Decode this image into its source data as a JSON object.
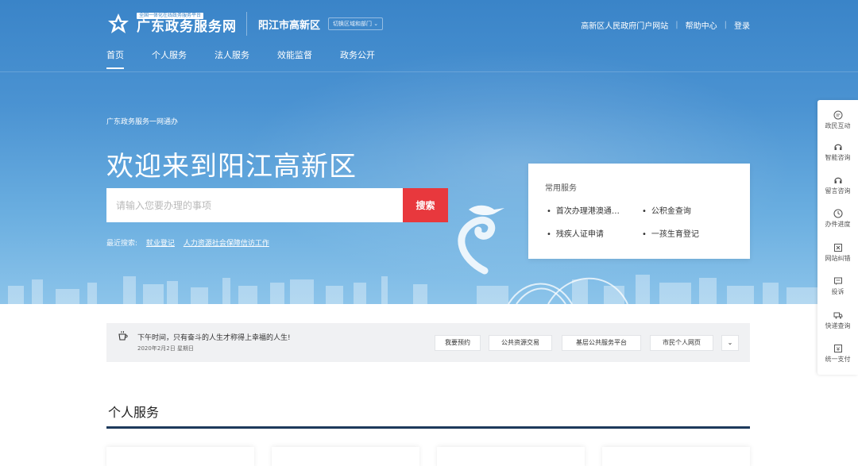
{
  "header": {
    "logo_small": "全国一体化在线政务服务平台",
    "logo_big": "广东政务服务网",
    "region": "阳江市高新区",
    "switch_label": "切换区域和部门",
    "top_links": [
      "高新区人民政府门户网站",
      "帮助中心",
      "登录"
    ]
  },
  "nav": [
    "首页",
    "个人服务",
    "法人服务",
    "效能监督",
    "政务公开"
  ],
  "hero": {
    "tagline": "广东政务服务一网通办",
    "welcome": "欢迎来到阳江高新区",
    "search_placeholder": "请输入您要办理的事项",
    "search_button": "搜索",
    "recent_label": "最近搜索:",
    "recent_items": [
      "就业登记",
      "人力资源社会保障信访工作"
    ]
  },
  "common_services": {
    "title": "常用服务",
    "items": [
      "首次办理港澳通…",
      "公积金查询",
      "残疾人证申请",
      "一孩生育登记"
    ]
  },
  "float_bar": [
    {
      "label": "政民互动",
      "icon": "chat-icon"
    },
    {
      "label": "智能咨询",
      "icon": "headset-icon"
    },
    {
      "label": "留言咨询",
      "icon": "headset-icon"
    },
    {
      "label": "办件进度",
      "icon": "clock-icon"
    },
    {
      "label": "网站纠错",
      "icon": "error-report-icon"
    },
    {
      "label": "投诉",
      "icon": "complaint-icon"
    },
    {
      "label": "快递查询",
      "icon": "delivery-icon"
    },
    {
      "label": "统一支付",
      "icon": "payment-icon"
    }
  ],
  "notice": {
    "text": "下午时间，只有奋斗的人生才称得上幸福的人生!",
    "date": "2020年2月2日 星期日",
    "quick_links": [
      "我要预约",
      "公共资源交易",
      "基层公共服务平台",
      "市民个人网页"
    ]
  },
  "section": {
    "title": "个人服务"
  },
  "colors": {
    "hero_blue": "#3a84c8",
    "search_red": "#e8383d",
    "section_line": "#1d3a5c"
  }
}
